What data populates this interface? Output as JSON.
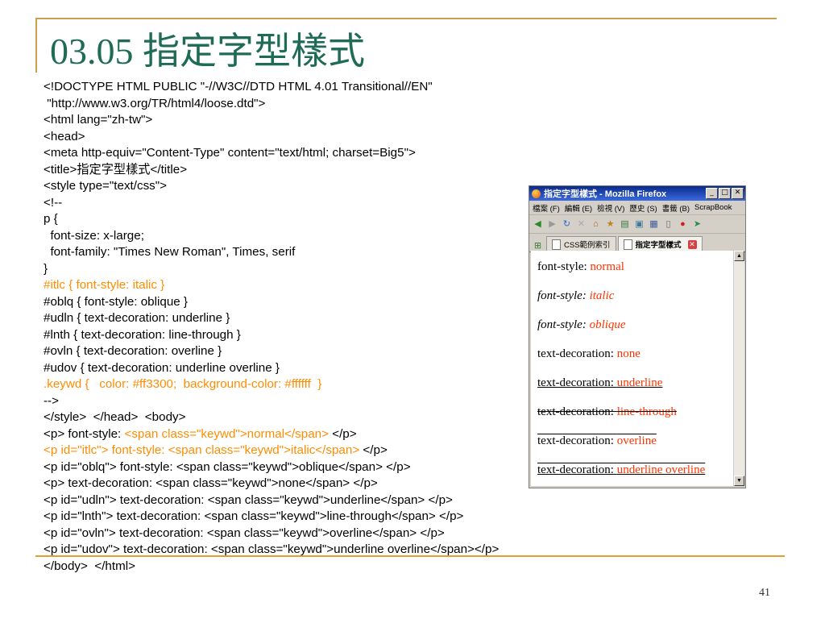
{
  "slide": {
    "title": "03.05 指定字型樣式",
    "page_number": "41"
  },
  "code_lines": [
    "<!DOCTYPE HTML PUBLIC \"-//W3C//DTD HTML 4.01 Transitional//EN\"",
    " \"http://www.w3.org/TR/html4/loose.dtd\">",
    "<html lang=\"zh-tw\">",
    "<head>",
    "<meta http-equiv=\"Content-Type\" content=\"text/html; charset=Big5\">",
    "<title>指定字型樣式</title>",
    "<style type=\"text/css\">",
    "<!--",
    "p {",
    "  font-size: x-large;",
    "  font-family: \"Times New Roman\", Times, serif",
    "}",
    "#itlc { font-style: italic }",
    "#oblq { font-style: oblique }",
    "#udln { text-decoration: underline }",
    "#lnth { text-decoration: line-through }",
    "#ovln { text-decoration: overline }",
    "#udov { text-decoration: underline overline }",
    ".keywd {   color: #ff3300;  background-color: #ffffff  }",
    "-->",
    "</style>  </head>  <body>",
    "<p> font-style: ",
    "<span class=\"keywd\">normal</span>",
    " </p>",
    "<p id=\"itlc\"> font-style: <span class=\"keywd\">italic</span>",
    " </p>",
    "<p id=\"oblq\"> font-style: <span class=\"keywd\">oblique</span> </p>",
    "<p> text-decoration: <span class=\"keywd\">none</span> </p>",
    "<p id=\"udln\"> text-decoration: <span class=\"keywd\">underline</span> </p>",
    "<p id=\"lnth\"> text-decoration: <span class=\"keywd\">line-through</span> </p>",
    "<p id=\"ovln\"> text-decoration: <span class=\"keywd\">overline</span> </p>",
    "<p id=\"udov\"> text-decoration: <span class=\"keywd\">underline overline</span></p>",
    "</body>  </html>"
  ],
  "browser": {
    "window_title": "指定字型樣式 - Mozilla Firefox",
    "window_buttons": [
      "_",
      "□",
      "✕"
    ],
    "menu": [
      "檔案 (F)",
      "編輯 (E)",
      "檢視 (V)",
      "歷史 (S)",
      "書籤 (B)",
      "ScrapBook"
    ],
    "tabs": [
      {
        "label": "CSS範例索引"
      },
      {
        "label": "指定字型樣式"
      }
    ],
    "demo": {
      "labels": {
        "font_style": "font-style:",
        "text_decoration": "text-decoration:"
      },
      "values": {
        "normal": "normal",
        "italic": "italic",
        "oblique": "oblique",
        "none": "none",
        "underline": "underline",
        "line_through": "line-through",
        "overline": "overline",
        "underline_overline": "underline overline"
      }
    }
  },
  "colors": {
    "title": "#1f6b56",
    "highlight_code": "#ff8c00",
    "keyword": "#ff3300",
    "rule": "#c9a14b"
  }
}
